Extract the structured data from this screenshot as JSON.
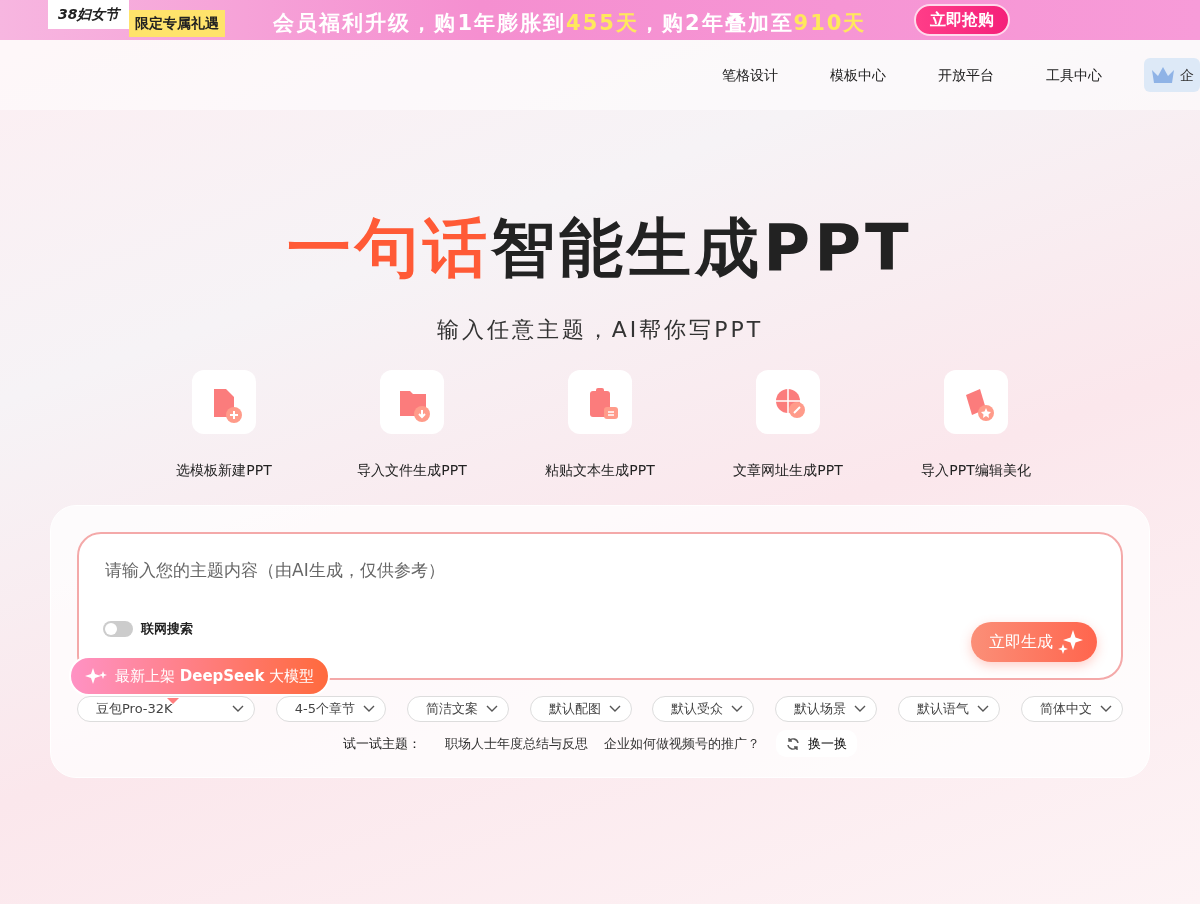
{
  "promo_banner": {
    "event_tag": "38妇女节",
    "offer_tag": "限定专属礼遇",
    "message": [
      {
        "text": "会员福利升级，购1年膨胀到",
        "highlight": false
      },
      {
        "text": "455",
        "highlight": true
      },
      {
        "text": "天",
        "highlight": true
      },
      {
        "text": "，购2年叠加至",
        "highlight": false
      },
      {
        "text": "910天",
        "highlight": true
      }
    ],
    "button": "立即抢购"
  },
  "nav": {
    "items": [
      "笔格设计",
      "模板中心",
      "开放平台",
      "工具中心"
    ],
    "vip_label": "企"
  },
  "hero": {
    "title": [
      {
        "text": "一句话",
        "accent": true
      },
      {
        "text": "智能生成PPT",
        "accent": false
      }
    ],
    "subtitle": "输入任意主题，AI帮你写PPT"
  },
  "modes": [
    {
      "kind": "template",
      "label": "选模板新建PPT"
    },
    {
      "kind": "file",
      "label": "导入文件生成PPT"
    },
    {
      "kind": "paste",
      "label": "粘贴文本生成PPT"
    },
    {
      "kind": "link",
      "label": "文章网址生成PPT"
    },
    {
      "kind": "beautify",
      "label": "导入PPT编辑美化"
    }
  ],
  "composer": {
    "placeholder": "请输入您的主题内容（由AI生成，仅供参考）",
    "web_search": {
      "label": "联网搜索",
      "on": false
    },
    "generate_button": "立即生成",
    "tooltip": "最新上架 **DeepSeek** 大模型",
    "options": [
      "豆包Pro-32K",
      "4-5个章节",
      "简洁文案",
      "默认配图",
      "默认受众",
      "默认场景",
      "默认语气",
      "简体中文"
    ],
    "suggestions_label": "试一试主题：",
    "suggestions": [
      "职场人士年度总结与反思",
      "企业如何做视频号的推广？"
    ],
    "refresh_button": "换一换"
  }
}
